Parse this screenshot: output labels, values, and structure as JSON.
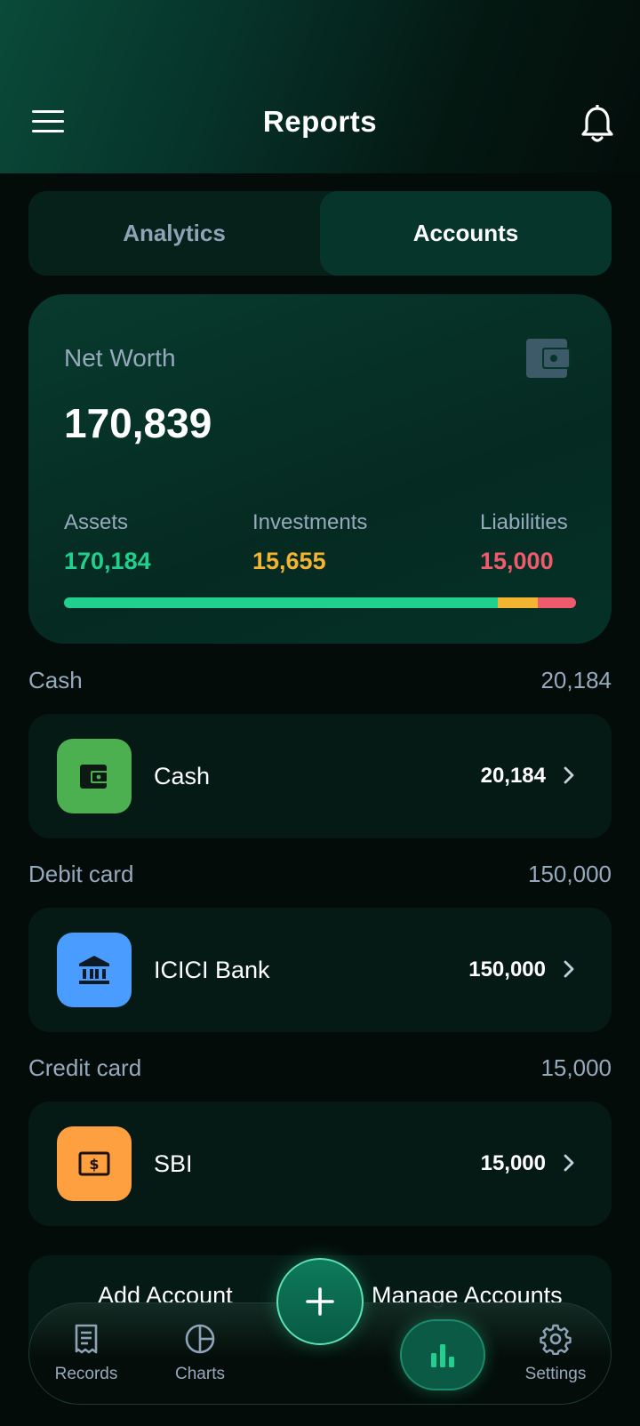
{
  "header": {
    "title": "Reports"
  },
  "tabs": [
    {
      "label": "Analytics",
      "active": false
    },
    {
      "label": "Accounts",
      "active": true
    }
  ],
  "net_worth": {
    "label": "Net Worth",
    "value": "170,839",
    "assets": {
      "label": "Assets",
      "value": "170,184",
      "color": "#1fd08e"
    },
    "investments": {
      "label": "Investments",
      "value": "15,655",
      "color": "#f3b431"
    },
    "liabilities": {
      "label": "Liabilities",
      "value": "15,000",
      "color": "#ef5b6c"
    },
    "bar_fractions": {
      "assets": 0.848,
      "investments": 0.078,
      "liabilities": 0.074
    }
  },
  "sections": [
    {
      "title": "Cash",
      "total": "20,184",
      "account": {
        "name": "Cash",
        "amount": "20,184",
        "icon": "wallet-icon",
        "icon_bg": "#4caf50"
      }
    },
    {
      "title": "Debit card",
      "total": "150,000",
      "account": {
        "name": "ICICI Bank",
        "amount": "150,000",
        "icon": "bank-icon",
        "icon_bg": "#4a9cff"
      }
    },
    {
      "title": "Credit card",
      "total": "15,000",
      "account": {
        "name": "SBI",
        "amount": "15,000",
        "icon": "dollar-bill-icon",
        "icon_bg": "#ffa040"
      }
    }
  ],
  "actions": {
    "add": "Add Account",
    "manage": "Manage Accounts"
  },
  "nav": {
    "records": "Records",
    "charts": "Charts",
    "settings": "Settings"
  }
}
